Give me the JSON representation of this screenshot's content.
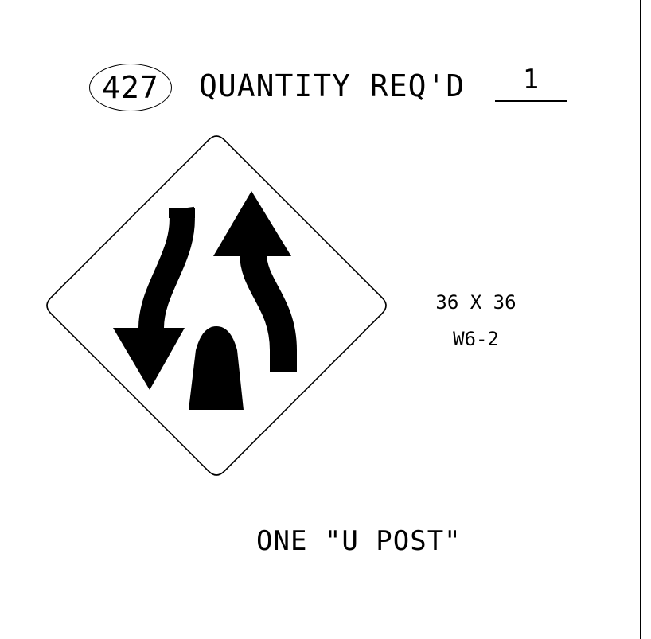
{
  "header": {
    "sign_number": "427",
    "quantity_label": "QUANTITY REQ'D",
    "quantity_value": "1"
  },
  "sign": {
    "size": "36 X 36",
    "code": "W6-2",
    "shape": "diamond",
    "symbol": "divided-highway-ends",
    "colors": {
      "background": "#ffffff",
      "legend": "#000000"
    }
  },
  "mounting": {
    "post_note": "ONE \"U POST\""
  }
}
